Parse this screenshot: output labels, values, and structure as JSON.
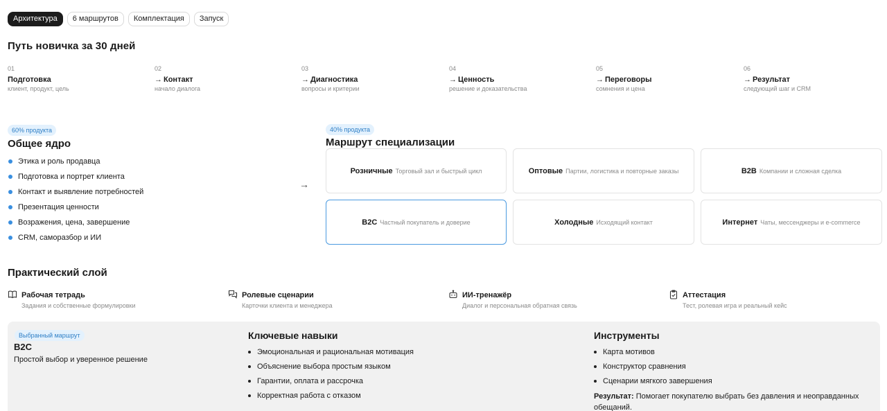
{
  "tabs": [
    {
      "label": "Архитектура",
      "active": true
    },
    {
      "label": "6 маршрутов",
      "active": false
    },
    {
      "label": "Комплектация",
      "active": false
    },
    {
      "label": "Запуск",
      "active": false
    }
  ],
  "path": {
    "title": "Путь новичка за 30 дней",
    "arrow_glyph": "→",
    "steps": [
      {
        "num": "01",
        "name": "Подготовка",
        "sub": "клиент, продукт, цель"
      },
      {
        "num": "02",
        "name": "Контакт",
        "sub": "начало диалога"
      },
      {
        "num": "03",
        "name": "Диагностика",
        "sub": "вопросы и критерии"
      },
      {
        "num": "04",
        "name": "Ценность",
        "sub": "решение и доказательства"
      },
      {
        "num": "05",
        "name": "Переговоры",
        "sub": "сомнения и цена"
      },
      {
        "num": "06",
        "name": "Результат",
        "sub": "следующий шаг и CRM"
      }
    ]
  },
  "core": {
    "badge": "60% продукта",
    "title": "Общее ядро",
    "items": [
      "Этика и роль продавца",
      "Подготовка и портрет клиента",
      "Контакт и выявление потребностей",
      "Презентация ценности",
      "Возражения, цена, завершение",
      "CRM, саморазбор и ИИ"
    ],
    "bullet_color": "#3a8fe0"
  },
  "connector_arrow": "→",
  "specialization": {
    "badge": "40% продукта",
    "title": "Маршрут специализации",
    "routes": [
      {
        "name": "Розничные",
        "desc": "Торговый зал и быстрый цикл",
        "selected": false
      },
      {
        "name": "Оптовые",
        "desc": "Партии, логистика и повторные заказы",
        "selected": false
      },
      {
        "name": "B2B",
        "desc": "Компании и сложная сделка",
        "selected": false
      },
      {
        "name": "B2C",
        "desc": "Частный покупатель и доверие",
        "selected": true
      },
      {
        "name": "Холодные",
        "desc": "Исходящий контакт",
        "selected": false
      },
      {
        "name": "Интернет",
        "desc": "Чаты, мессенджеры и e-commerce",
        "selected": false
      }
    ],
    "selected_border_color": "#4a9ae0"
  },
  "practical": {
    "title": "Практический слой",
    "items": [
      {
        "icon": "book-icon",
        "name": "Рабочая тетрадь",
        "desc": "Задания и собственные формулировки"
      },
      {
        "icon": "chat-bubbles-icon",
        "name": "Ролевые сценарии",
        "desc": "Карточки клиента и менеджера"
      },
      {
        "icon": "robot-icon",
        "name": "ИИ-тренажёр",
        "desc": "Диалог и персональная обратная связь"
      },
      {
        "icon": "clipboard-check-icon",
        "name": "Аттестация",
        "desc": "Тест, ролевая игра и реальный кейс"
      }
    ]
  },
  "selected_route": {
    "badge": "Выбранный маршрут",
    "name": "B2C",
    "desc": "Простой выбор и уверенное решение",
    "skills_title": "Ключевые навыки",
    "skills": [
      "Эмоциональная и рациональная мотивация",
      "Объяснение выбора простым языком",
      "Гарантии, оплата и рассрочка",
      "Корректная работа с отказом"
    ],
    "tools_title": "Инструменты",
    "tools": [
      "Карта мотивов",
      "Конструктор сравнения",
      "Сценарии мягкого завершения"
    ],
    "result_label": "Результат:",
    "result_text": "Помогает покупателю выбрать без давления и неоправданных обещаний."
  },
  "colors": {
    "accent": "#3a8fe0",
    "badge_bg": "#e3f1fd",
    "badge_text": "#2f7fc6",
    "active_tab_bg": "#1c1c1c",
    "panel_bg": "#f1f1f1"
  }
}
